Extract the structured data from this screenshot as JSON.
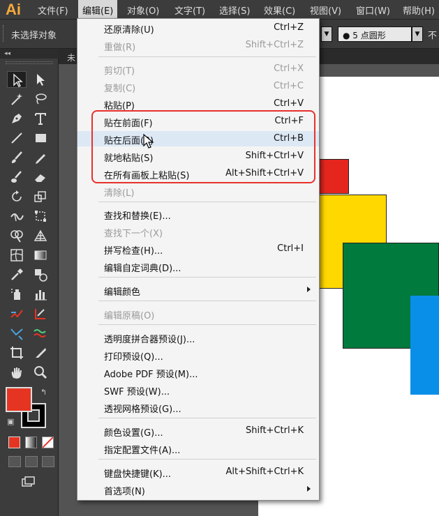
{
  "app": {
    "logo": "Ai"
  },
  "menubar": {
    "items": [
      "文件(F)",
      "编辑(E)",
      "对象(O)",
      "文字(T)",
      "选择(S)",
      "效果(C)",
      "视图(V)",
      "窗口(W)",
      "帮助(H)"
    ]
  },
  "controlbar": {
    "selection_label": "未选择对象",
    "brush_value": "● 5 点圆形",
    "trailing_text": "不"
  },
  "tools_panel": {
    "collapse_label": "◂◂"
  },
  "document": {
    "tab_label": "未"
  },
  "edit_menu": {
    "items": [
      {
        "label": "还原清除(U)",
        "shortcut": "Ctrl+Z"
      },
      {
        "label": "重做(R)",
        "shortcut": "Shift+Ctrl+Z"
      },
      {
        "label": "剪切(T)",
        "shortcut": "Ctrl+X"
      },
      {
        "label": "复制(C)",
        "shortcut": "Ctrl+C"
      },
      {
        "label": "粘贴(P)",
        "shortcut": "Ctrl+V"
      },
      {
        "label": "贴在前面(F)",
        "shortcut": "Ctrl+F"
      },
      {
        "label": "贴在后面(B)",
        "shortcut": "Ctrl+B"
      },
      {
        "label": "就地粘贴(S)",
        "shortcut": "Shift+Ctrl+V"
      },
      {
        "label": "在所有画板上粘贴(S)",
        "shortcut": "Alt+Shift+Ctrl+V"
      },
      {
        "label": "清除(L)",
        "shortcut": ""
      },
      {
        "label": "查找和替换(E)...",
        "shortcut": ""
      },
      {
        "label": "查找下一个(X)",
        "shortcut": ""
      },
      {
        "label": "拼写检查(H)...",
        "shortcut": "Ctrl+I"
      },
      {
        "label": "编辑自定词典(D)...",
        "shortcut": ""
      },
      {
        "label": "编辑颜色",
        "shortcut": ""
      },
      {
        "label": "编辑原稿(O)",
        "shortcut": ""
      },
      {
        "label": "透明度拼合器预设(J)...",
        "shortcut": ""
      },
      {
        "label": "打印预设(Q)...",
        "shortcut": ""
      },
      {
        "label": "Adobe PDF 预设(M)...",
        "shortcut": ""
      },
      {
        "label": "SWF 预设(W)...",
        "shortcut": ""
      },
      {
        "label": "透视网格预设(G)...",
        "shortcut": ""
      },
      {
        "label": "颜色设置(G)...",
        "shortcut": "Shift+Ctrl+K"
      },
      {
        "label": "指定配置文件(A)...",
        "shortcut": ""
      },
      {
        "label": "键盘快捷键(K)...",
        "shortcut": "Alt+Shift+Ctrl+K"
      },
      {
        "label": "首选项(N)",
        "shortcut": ""
      }
    ]
  },
  "colors": {
    "fill_swatch": "#e53522",
    "stroke_swatch": "#000000",
    "highlight_box": "#e8312b",
    "shape_red": "#e5261f",
    "shape_yellow": "#ffd800",
    "shape_green": "#007a3d",
    "shape_blue": "#0a8fe8"
  }
}
